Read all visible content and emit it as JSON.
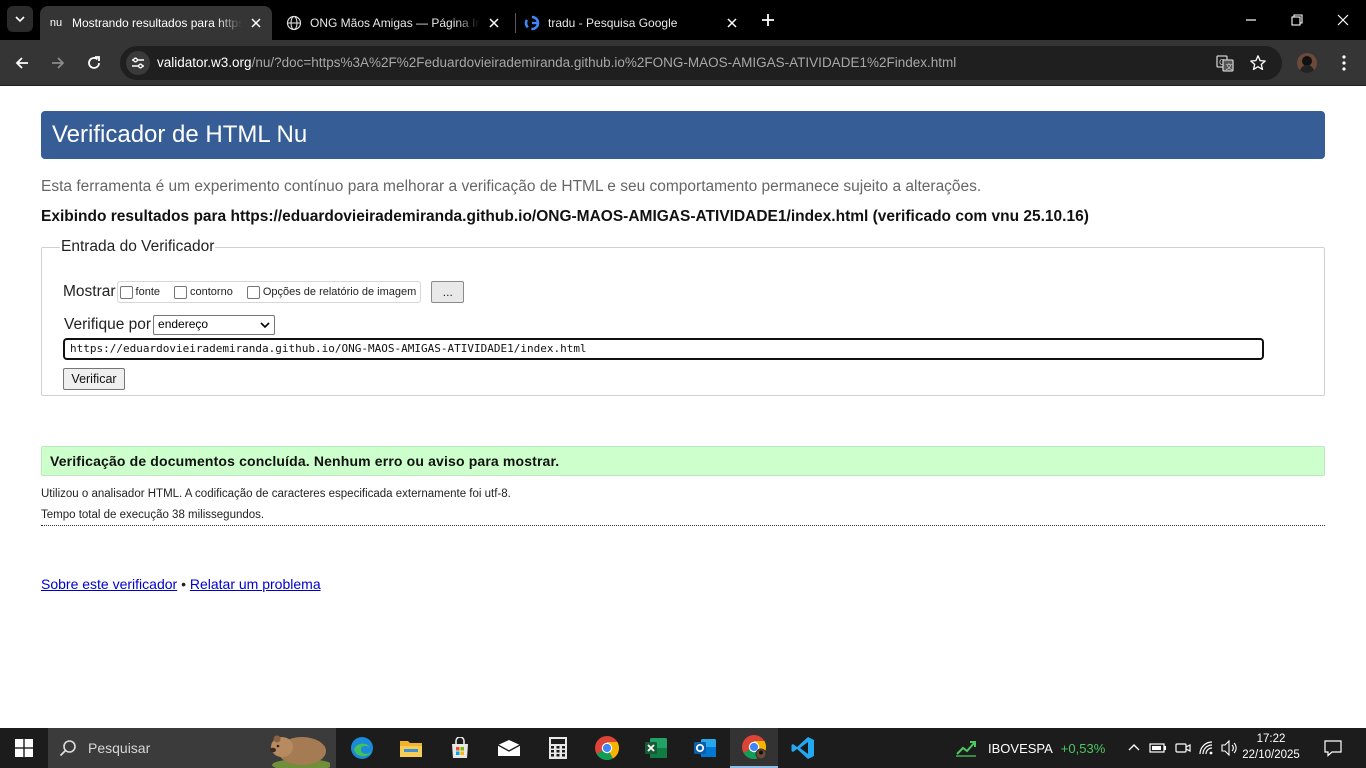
{
  "browser": {
    "tabs": [
      {
        "favicon_text": "nu",
        "title": "Mostrando resultados para https://eduardovieirademiranda.github.io",
        "active": true
      },
      {
        "title": "ONG Mãos Amigas — Página Inicial",
        "active": false
      },
      {
        "title": "tradu - Pesquisa Google",
        "active": false
      }
    ],
    "url_host": "validator.w3.org",
    "url_rest": "/nu/?doc=https%3A%2F%2Feduardovieirademiranda.github.io%2FONG-MAOS-AMIGAS-ATIVIDADE1%2Findex.html"
  },
  "page": {
    "header_title": "Verificador de HTML Nu",
    "intro": "Esta ferramenta é um experimento contínuo para melhorar a verificação de HTML e seu comportamento permanece sujeito a alterações.",
    "results_for": "Exibindo resultados para https://eduardovieirademiranda.github.io/ONG-MAOS-AMIGAS-ATIVIDADE1/index.html (verificado com vnu 25.10.16)",
    "checker": {
      "legend": "Entrada do Verificador",
      "show_label": "Mostrar",
      "options": [
        "fonte",
        "contorno",
        "Opções de relatório de imagem"
      ],
      "more_button": "...",
      "check_by_label": "Verifique por",
      "check_by_value": "endereço",
      "url_value": "https://eduardovieirademiranda.github.io/ONG-MAOS-AMIGAS-ATIVIDADE1/index.html",
      "verify_button": "Verificar"
    },
    "success_message": "Verificação de documentos concluída. Nenhum erro ou aviso para mostrar.",
    "details": [
      "Utilizou o analisador HTML. A codificação de caracteres especificada externamente foi utf-8.",
      "Tempo total de execução 38 milissegundos."
    ],
    "footer": {
      "about_link": "Sobre este verificador",
      "separator": "•",
      "report_link": "Relatar um problema"
    }
  },
  "taskbar": {
    "search_placeholder": "Pesquisar",
    "apps": [
      "edge-icon",
      "file-explorer-icon",
      "store-icon",
      "mail-icon",
      "calculator-icon",
      "chrome-icon",
      "excel-icon",
      "outlook-icon",
      "chrome-profile-icon",
      "vscode-icon"
    ],
    "ticker_name": "IBOVESPA",
    "ticker_change": "+0,53%",
    "time": "17:22",
    "date": "22/10/2025"
  }
}
